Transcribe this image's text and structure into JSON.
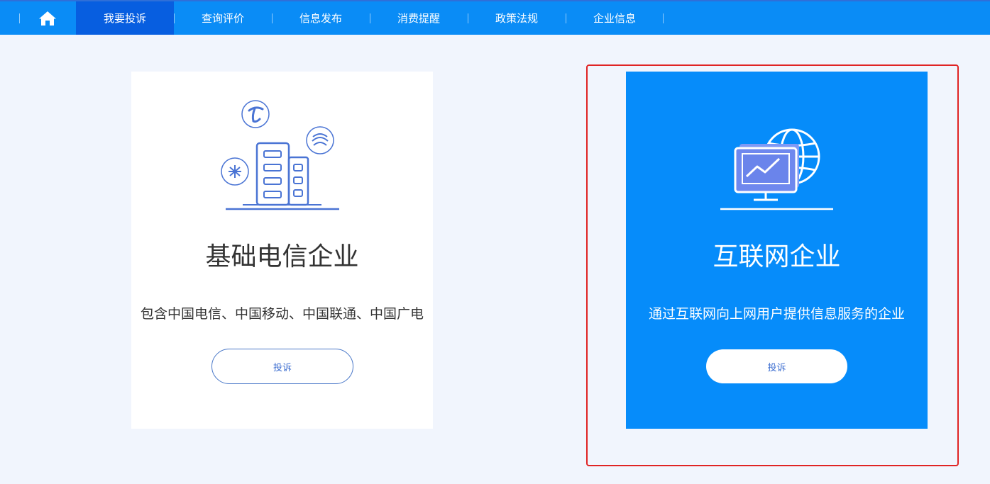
{
  "nav": {
    "home_icon": "home-icon",
    "items": [
      {
        "label": "我要投诉",
        "active": true
      },
      {
        "label": "查询评价",
        "active": false
      },
      {
        "label": "信息发布",
        "active": false
      },
      {
        "label": "消费提醒",
        "active": false
      },
      {
        "label": "政策法规",
        "active": false
      },
      {
        "label": "企业信息",
        "active": false
      }
    ]
  },
  "cards": {
    "telecom": {
      "title": "基础电信企业",
      "description": "包含中国电信、中国移动、中国联通、中国广电",
      "button_label": "投诉",
      "icon": "telecom-buildings-icon"
    },
    "internet": {
      "title": "互联网企业",
      "description": "通过互联网向上网用户提供信息服务的企业",
      "button_label": "投诉",
      "icon": "internet-monitor-globe-icon"
    }
  },
  "colors": {
    "nav_bg": "#0a8cf6",
    "nav_active": "#075ee0",
    "page_bg": "#f1f5fd",
    "card_highlight_bg": "#068cfa",
    "illustration_stroke": "#4a74d4",
    "highlight_border": "#e02424"
  }
}
